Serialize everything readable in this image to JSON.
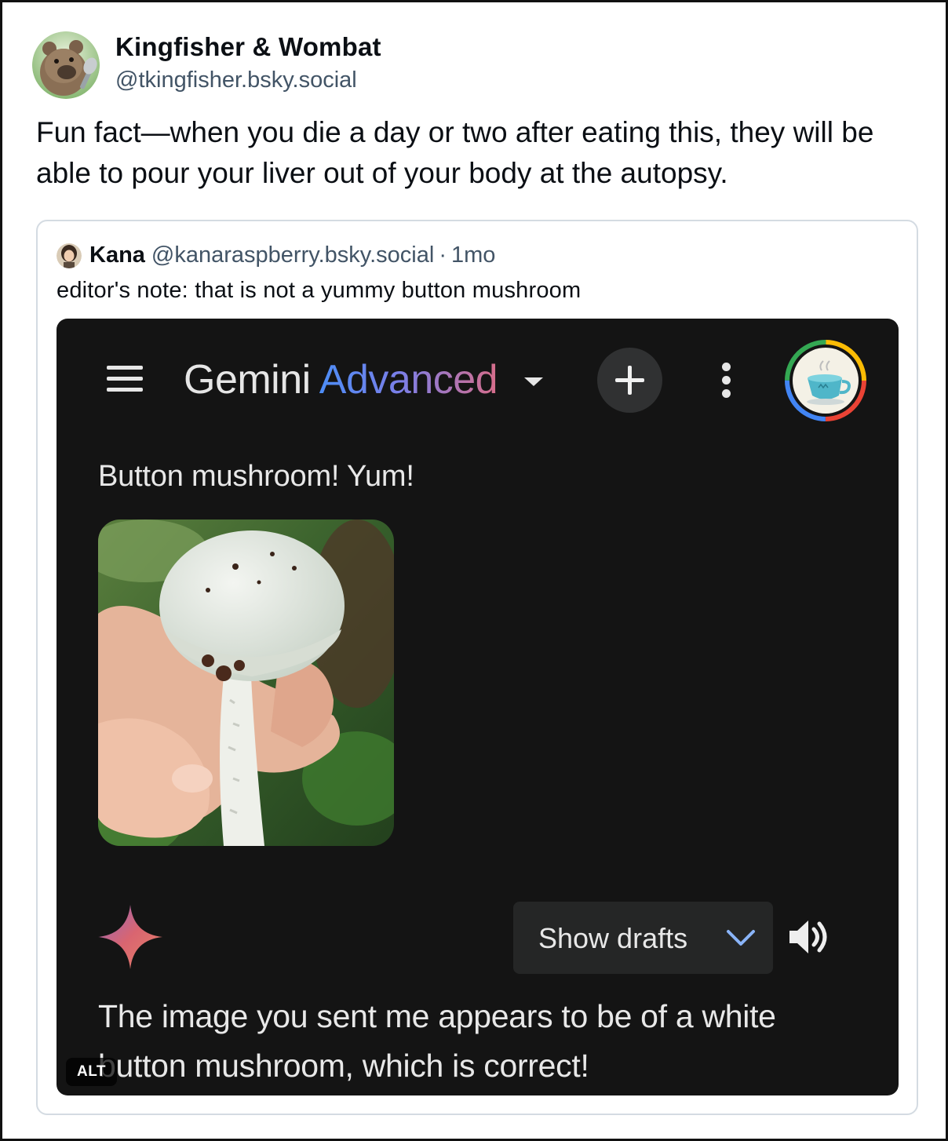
{
  "post": {
    "author": {
      "display_name": "Kingfisher & Wombat",
      "handle": "@tkingfisher.bsky.social",
      "avatar_icon": "wombat-avatar-icon"
    },
    "text": "Fun fact—when you die a day or two after eating this, they will be able to pour your liver out of your body at the autopsy."
  },
  "quote": {
    "author": {
      "display_name": "Kana",
      "handle": "@kanaraspberry.bsky.social",
      "separator": "·",
      "time": "1mo"
    },
    "text": "editor's note: that is not a yummy button mushroom",
    "alt_badge": "ALT"
  },
  "screenshot": {
    "app_title_prefix": "Gemini",
    "app_title_suffix": "Advanced",
    "user_prompt": "Button mushroom! Yum!",
    "show_drafts_label": "Show drafts",
    "response_text": "The image you sent me appears to be of a white button mushroom, which is correct!",
    "icons": [
      "menu-icon",
      "dropdown-caret-icon",
      "new-chat-plus-icon",
      "more-vert-icon",
      "profile-teacup-icon",
      "gemini-sparkle-icon",
      "chevron-down-icon",
      "speaker-icon"
    ]
  },
  "colors": {
    "text_primary": "#0b0f14",
    "text_secondary": "#425466",
    "quote_border": "#d4dbe2",
    "screenshot_bg": "#141414",
    "chip_bg": "#252626",
    "gemini_blue": "#4c8df6",
    "gemini_pink": "#d76d8a"
  }
}
